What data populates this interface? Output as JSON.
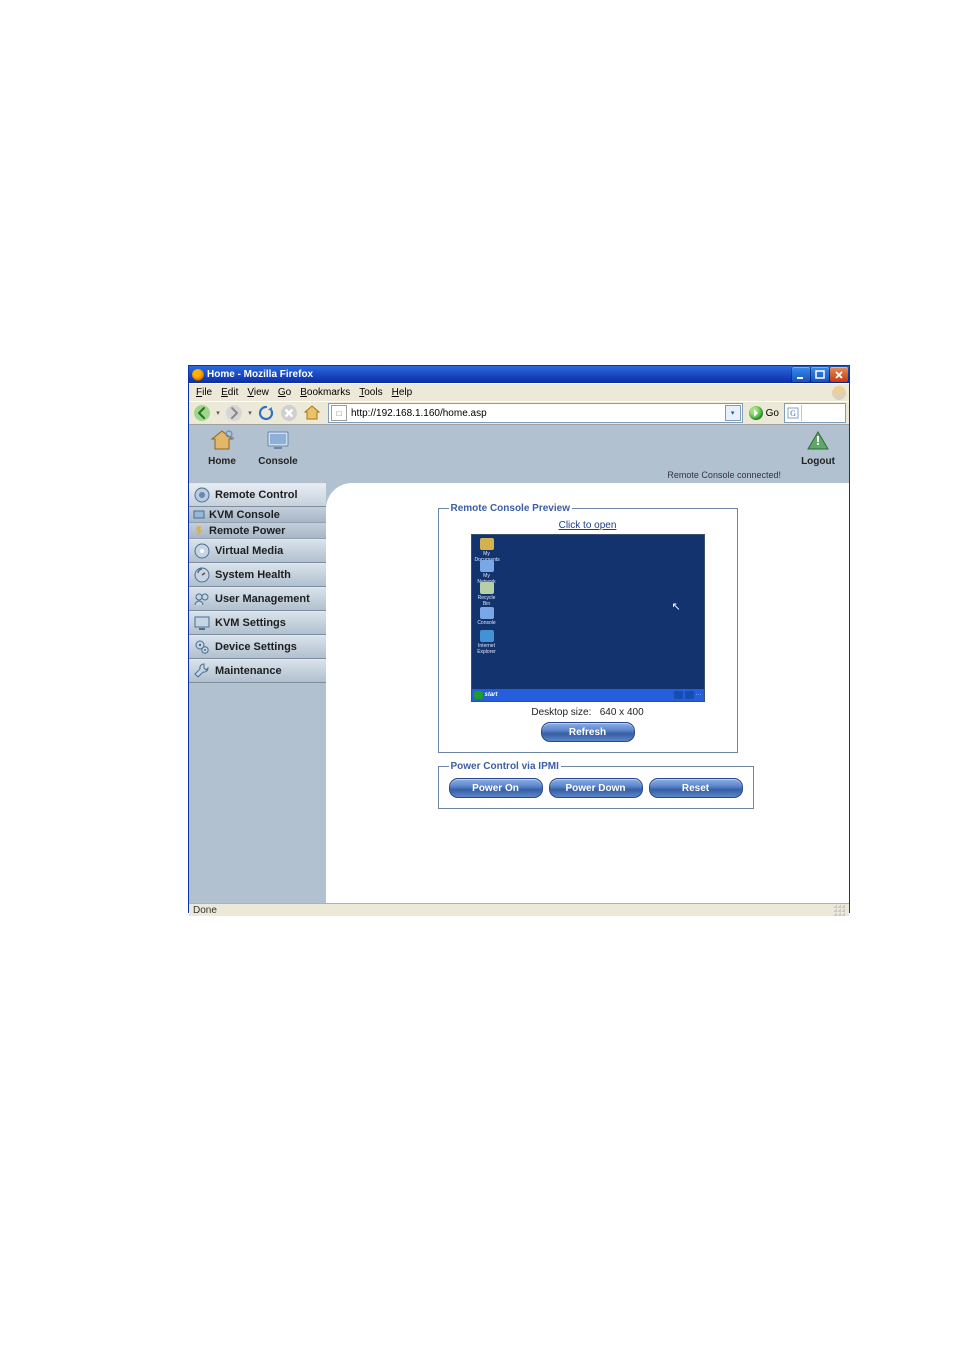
{
  "window": {
    "title": "Home - Mozilla Firefox"
  },
  "menu": {
    "file": "File",
    "edit": "Edit",
    "view": "View",
    "go": "Go",
    "bookmarks": "Bookmarks",
    "tools": "Tools",
    "help": "Help"
  },
  "toolbar": {
    "back_icon": "back-arrow",
    "forward_icon": "forward-arrow",
    "reload_icon": "reload",
    "stop_icon": "stop",
    "home_icon": "home",
    "url": "http://192.168.1.160/home.asp",
    "go_label": "Go",
    "search_placeholder": ""
  },
  "header": {
    "home_label": "Home",
    "console_label": "Console",
    "logout_label": "Logout",
    "status": "Remote Console connected!"
  },
  "sidebar": {
    "items": [
      {
        "label": "Remote Control",
        "icon": "remote-control-icon"
      },
      {
        "label": "Virtual Media",
        "icon": "virtual-media-icon"
      },
      {
        "label": "System Health",
        "icon": "system-health-icon"
      },
      {
        "label": "User Management",
        "icon": "user-management-icon"
      },
      {
        "label": "KVM Settings",
        "icon": "kvm-settings-icon"
      },
      {
        "label": "Device Settings",
        "icon": "device-settings-icon"
      },
      {
        "label": "Maintenance",
        "icon": "maintenance-icon"
      }
    ],
    "sub": {
      "kvm": "KVM Console",
      "power": "Remote Power"
    }
  },
  "main": {
    "preview_legend": "Remote Console Preview",
    "click_to_open": "Click to open",
    "desktop_size_label": "Desktop size:",
    "desktop_size_value": "640 x 400",
    "refresh": "Refresh",
    "pcv_legend": "Power Control via IPMI",
    "power_on": "Power On",
    "power_down": "Power Down",
    "reset": "Reset",
    "remote_desktop": {
      "icons": [
        "My Documents",
        "My Network",
        "Recycle Bin",
        "Console",
        "Internet Explorer"
      ]
    }
  },
  "statusbar": {
    "text": "Done"
  }
}
